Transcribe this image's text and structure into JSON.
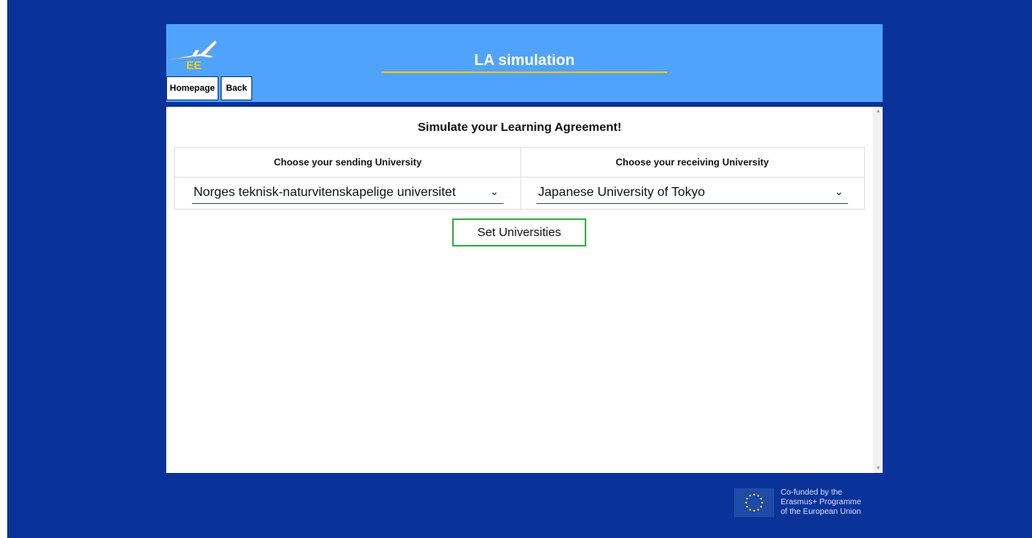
{
  "header": {
    "title": "LA simulation",
    "nav": {
      "homepage": "Homepage",
      "back": "Back"
    },
    "logo_text": "EE",
    "colors": {
      "header_bg": "#4fa3fa",
      "underline": "#f0c419",
      "page_bg": "#0a3399"
    }
  },
  "main": {
    "heading": "Simulate your Learning Agreement!",
    "sending": {
      "label": "Choose your sending University",
      "value": "Norges teknisk-naturvitenskapelige universitet"
    },
    "receiving": {
      "label": "Choose your receiving University",
      "value": "Japanese University of Tokyo"
    },
    "set_button": "Set Universities"
  },
  "footer": {
    "eu_line1": "Co-funded by the",
    "eu_line2": "Erasmus+ Programme",
    "eu_line3": "of the European Union",
    "flag_icon": "eu-flag-icon"
  }
}
